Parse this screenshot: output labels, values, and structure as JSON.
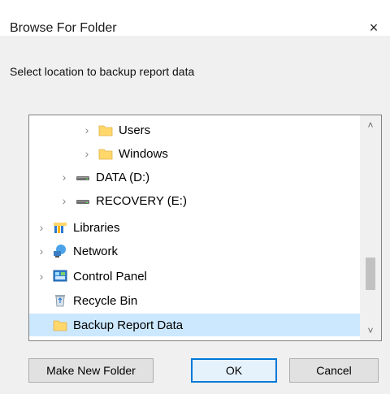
{
  "dialog": {
    "title": "Browse For Folder",
    "close_symbol": "×",
    "prompt": "Select location to backup report data"
  },
  "tree": {
    "items": [
      {
        "label": "Users",
        "icon": "folder-icon",
        "expandable": true,
        "indent": 2
      },
      {
        "label": "Windows",
        "icon": "folder-icon",
        "expandable": true,
        "indent": 2
      },
      {
        "label": "DATA (D:)",
        "icon": "drive-icon",
        "expandable": true,
        "indent": 1
      },
      {
        "label": "RECOVERY (E:)",
        "icon": "drive-icon",
        "expandable": true,
        "indent": 1
      },
      {
        "label": "Libraries",
        "icon": "libraries-icon",
        "expandable": true,
        "indent": 0
      },
      {
        "label": "Network",
        "icon": "network-icon",
        "expandable": true,
        "indent": 0
      },
      {
        "label": "Control Panel",
        "icon": "control-panel-icon",
        "expandable": true,
        "indent": 0
      },
      {
        "label": "Recycle Bin",
        "icon": "recycle-bin-icon",
        "expandable": false,
        "indent": 0
      },
      {
        "label": "Backup Report Data",
        "icon": "folder-icon",
        "expandable": false,
        "indent": 0,
        "selected": true
      }
    ],
    "chevron": "›",
    "scroll_up": "˄",
    "scroll_down": "˅"
  },
  "buttons": {
    "make_new_folder": "Make New Folder",
    "ok": "OK",
    "cancel": "Cancel"
  },
  "colors": {
    "selection": "#cce8ff",
    "folder": "#ffd76a",
    "accent": "#0078d7"
  }
}
